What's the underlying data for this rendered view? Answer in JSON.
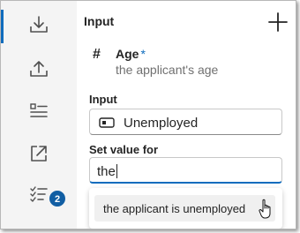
{
  "rail": {
    "items": [
      {
        "name": "import-icon",
        "active": true
      },
      {
        "name": "export-icon",
        "active": false
      },
      {
        "name": "list-icon",
        "active": false
      },
      {
        "name": "open-external-icon",
        "active": false
      },
      {
        "name": "checklist-icon",
        "active": false,
        "badge": "2"
      }
    ]
  },
  "panel": {
    "title": "Input",
    "add_icon": "plus-icon"
  },
  "parameter": {
    "icon": "#",
    "name": "Age",
    "required_mark": "*",
    "description": "the applicant's age"
  },
  "input_section": {
    "label": "Input",
    "value": "Unemployed",
    "value_icon": "text-field-icon"
  },
  "set_value": {
    "label": "Set value for",
    "value": "the"
  },
  "suggestions": [
    "the applicant is unemployed"
  ],
  "colors": {
    "accent": "#0f6cbd",
    "badge": "#115ea3",
    "rail_bg": "#f4f4f4"
  }
}
